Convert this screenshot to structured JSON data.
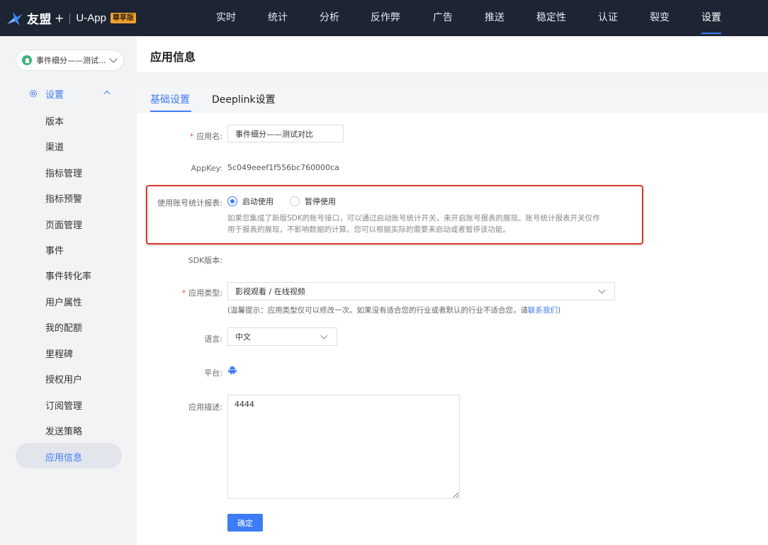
{
  "colors": {
    "topbar": "#1d2433",
    "accent": "#3d7cf5",
    "required": "#e8533c",
    "highlight_border": "#e0392b",
    "badge": "#f0a030"
  },
  "brand": {
    "name": "友盟",
    "plus": "+",
    "product": "U-App",
    "badge": "尊享版",
    "icon": "umeng-bird-icon"
  },
  "nav": {
    "items": [
      "实时",
      "统计",
      "分析",
      "反作弊",
      "广告",
      "推送",
      "稳定性",
      "认证",
      "裂变",
      "设置"
    ],
    "active": "设置"
  },
  "sidebar": {
    "app_selector": {
      "label": "事件细分——测试...",
      "icon": "android-icon"
    },
    "group": {
      "label": "设置",
      "icon": "gear-icon",
      "expand_icon": "chevron-up-icon"
    },
    "items": [
      "版本",
      "渠道",
      "指标管理",
      "指标预警",
      "页面管理",
      "事件",
      "事件转化率",
      "用户属性",
      "我的配额",
      "里程碑",
      "授权用户",
      "订阅管理",
      "发送策略",
      "应用信息"
    ],
    "active": "应用信息"
  },
  "page": {
    "title": "应用信息"
  },
  "tabs": {
    "basic": "基础设置",
    "deeplink": "Deeplink设置",
    "active": "基础设置"
  },
  "form": {
    "app_name": {
      "required_mark": "*",
      "label": "应用名:",
      "value": "事件细分——测试对比"
    },
    "appkey": {
      "label": "AppKey:",
      "value": "5c049eeef1f556bc760000ca"
    },
    "account_stats": {
      "label": "使用账号统计报表:",
      "option_enable": "启动使用",
      "option_pause": "暂停使用",
      "selected": "启动使用",
      "help_line1": "如果您集成了新版SDK的账号接口，可以通过启动账号统计开关，来开启账号报表的展现。账号统计报表开关仅作",
      "help_line2": "用于报表的展现，不影响数据的计算。您可以根据实际的需要来启动或者暂停该功能。"
    },
    "sdk_version": {
      "label": "SDK版本:",
      "value": ""
    },
    "app_type": {
      "required_mark": "*",
      "label": "应用类型:",
      "value": "影视观看 / 在线视频",
      "tip_prefix": "(温馨提示：应用类型仅可以修改一次。如果没有适合您的行业或者默认的行业不适合您，请",
      "tip_link": "联系我们",
      "tip_suffix": ")"
    },
    "language": {
      "label": "语言:",
      "value": "中文"
    },
    "platform": {
      "label": "平台:",
      "icon": "android-icon"
    },
    "description": {
      "label": "应用描述:",
      "value": "4444"
    },
    "submit_label": "确定"
  }
}
